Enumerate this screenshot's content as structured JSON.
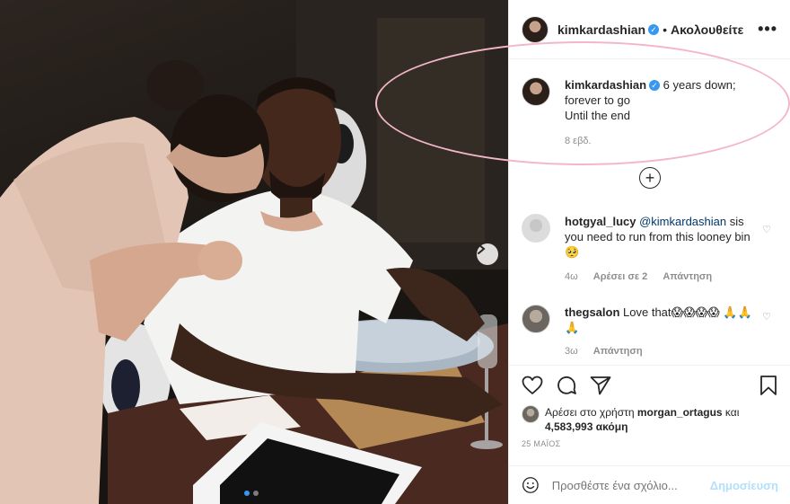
{
  "post": {
    "username": "kimkardashian",
    "follow_separator": "•",
    "follow_label": "Ακολουθείτε",
    "more_icon": "•••"
  },
  "caption": {
    "username": "kimkardashian",
    "text_line1": "6 years down;",
    "text_line2": "forever to go",
    "text_line3": "Until the end",
    "time": "8 εβδ."
  },
  "load_more_icon": "+",
  "comments": [
    {
      "username": "hotgyal_lucy",
      "mention": "@kimkardashian",
      "text": "sis you need to run from this looney bin 🥺",
      "time": "4ω",
      "likes": "Αρέσει σε 2",
      "reply": "Απάντηση"
    },
    {
      "username": "thegsalon",
      "text": "Love that😱😱😱😱 🙏🙏🙏",
      "time": "3ω",
      "reply": "Απάντηση"
    }
  ],
  "likes_line": {
    "prefix": "Αρέσει στο χρήστη",
    "user": "morgan_ortagus",
    "conj": "και",
    "count": "4,583,993",
    "suffix": "ακόμη"
  },
  "date": "25 ΜΑΪΟΣ",
  "add_comment": {
    "placeholder": "Προσθέστε ένα σχόλιο...",
    "post_label": "Δημοσίευση"
  },
  "carousel": {
    "slide_count": 2,
    "active_index": 0
  },
  "colors": {
    "accent": "#3897f0",
    "highlight": "#f3b6c8",
    "post_disabled": "#b2dffc"
  }
}
